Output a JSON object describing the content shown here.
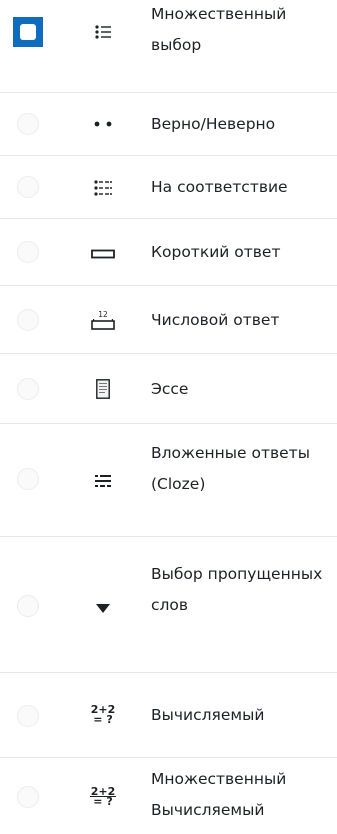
{
  "question_types": [
    {
      "label": "Множественный выбор",
      "icon": "multiple-choice-icon",
      "selected": true
    },
    {
      "label": "Верно/Неверно",
      "icon": "true-false-icon",
      "selected": false
    },
    {
      "label": "На соответствие",
      "icon": "matching-icon",
      "selected": false
    },
    {
      "label": "Короткий ответ",
      "icon": "short-answer-icon",
      "selected": false
    },
    {
      "label": "Числовой ответ",
      "icon": "numerical-icon",
      "selected": false
    },
    {
      "label": "Эссе",
      "icon": "essay-icon",
      "selected": false
    },
    {
      "label": "Вложенные ответы (Cloze)",
      "icon": "cloze-icon",
      "selected": false
    },
    {
      "label": "Выбор пропущенных слов",
      "icon": "select-missing-words-icon",
      "selected": false
    },
    {
      "label": "Вычисляемый",
      "icon": "calculated-icon",
      "selected": false
    },
    {
      "label": "Множественный Вычисляемый",
      "icon": "calculated-multichoice-icon",
      "selected": false
    }
  ],
  "icon_text": {
    "numerical_value": "12",
    "calc_top": "2+2",
    "calc_bottom": "= ?"
  },
  "colors": {
    "selected_radio": "#0f6cbf",
    "separator": "#e6e7e9",
    "text": "#1d2125"
  }
}
